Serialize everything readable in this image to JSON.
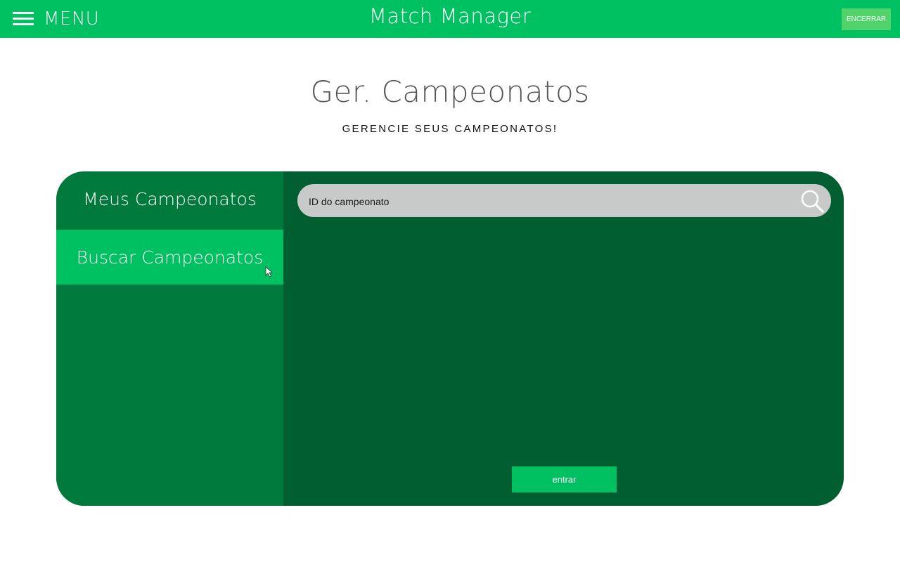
{
  "header": {
    "menu_label": "MENU",
    "app_title": "Match Manager",
    "end_label": "ENCERRAR"
  },
  "page": {
    "title": "Ger. Campeonatos",
    "subtitle": "GERENCIE SEUS CAMPEONATOS!"
  },
  "sidebar": {
    "items": [
      {
        "label": "Meus Campeonatos",
        "active": false
      },
      {
        "label": "Buscar Campeonatos",
        "active": true
      }
    ]
  },
  "search": {
    "placeholder": "ID do campeonato",
    "value": "",
    "icon": "search-icon"
  },
  "actions": {
    "enter_label": "entrar"
  },
  "colors": {
    "header_green": "#00c162",
    "panel_dark": "#005e30",
    "sidebar_green": "#007a3c",
    "active_item": "#00c162",
    "end_button": "#52d26b",
    "search_bg": "#c8cac9"
  }
}
